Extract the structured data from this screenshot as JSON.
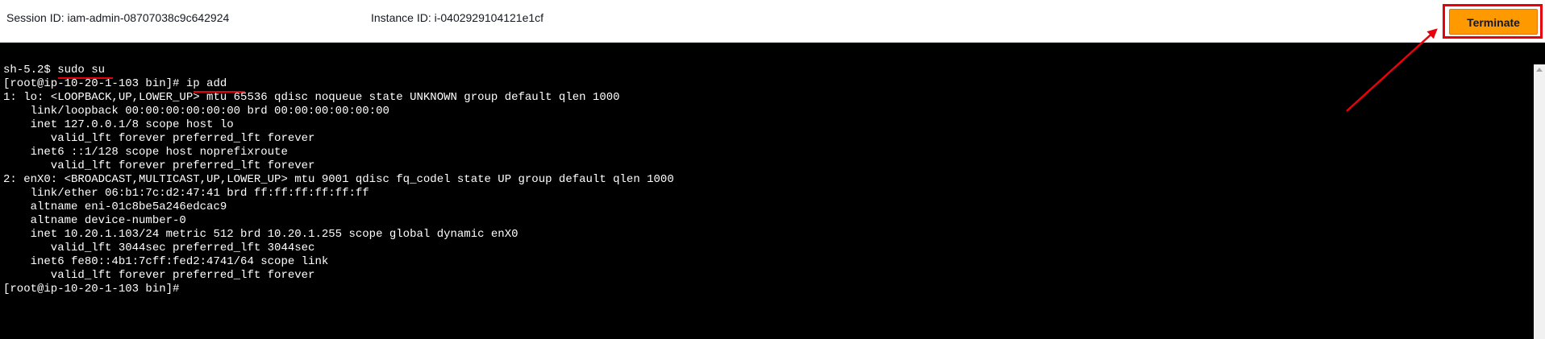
{
  "header": {
    "session_id": "Session ID: iam-admin-08707038c9c642924",
    "instance_id": "Instance ID: i-0402929104121e1cf",
    "terminate_label": "Terminate"
  },
  "terminal": {
    "lines": [
      "sh-5.2$ sudo su",
      "[root@ip-10-20-1-103 bin]# ip add",
      "1: lo: <LOOPBACK,UP,LOWER_UP> mtu 65536 qdisc noqueue state UNKNOWN group default qlen 1000",
      "    link/loopback 00:00:00:00:00:00 brd 00:00:00:00:00:00",
      "    inet 127.0.0.1/8 scope host lo",
      "       valid_lft forever preferred_lft forever",
      "    inet6 ::1/128 scope host noprefixroute",
      "       valid_lft forever preferred_lft forever",
      "2: enX0: <BROADCAST,MULTICAST,UP,LOWER_UP> mtu 9001 qdisc fq_codel state UP group default qlen 1000",
      "    link/ether 06:b1:7c:d2:47:41 brd ff:ff:ff:ff:ff:ff",
      "    altname eni-01c8be5a246edcac9",
      "    altname device-number-0",
      "    inet 10.20.1.103/24 metric 512 brd 10.20.1.255 scope global dynamic enX0",
      "       valid_lft 3044sec preferred_lft 3044sec",
      "    inet6 fe80::4b1:7cff:fed2:4741/64 scope link",
      "       valid_lft forever preferred_lft forever",
      "[root@ip-10-20-1-103 bin]#"
    ]
  },
  "colors": {
    "terminate_button": "#ff9900",
    "annotation_red": "#e8000b",
    "terminal_bg": "#000000",
    "terminal_fg": "#ffffff"
  },
  "icons": {
    "annotation_arrow": "arrow-icon",
    "scroll_up": "scroll-up-icon"
  }
}
